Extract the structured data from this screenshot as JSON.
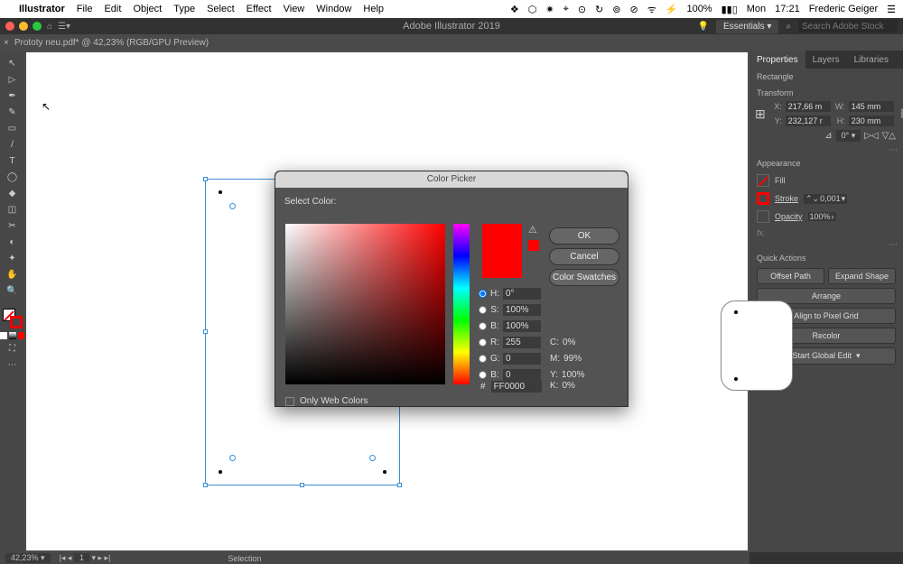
{
  "menubar": {
    "apple": "",
    "app": "Illustrator",
    "items": [
      "File",
      "Edit",
      "Object",
      "Type",
      "Select",
      "Effect",
      "View",
      "Window",
      "Help"
    ],
    "right_icons": [
      "❖",
      "⬡",
      "✷",
      "⌖",
      "⊙",
      "↻",
      "⊚",
      "⊘",
      "ᯤ",
      "⚡"
    ],
    "volume": "100%",
    "battery": "▮▮▯",
    "day": "Mon",
    "time": "17:21",
    "user": "Frederic Geiger",
    "menuicon": "☰"
  },
  "appbar": {
    "title": "Adobe Illustrator 2019",
    "workspace": "Essentials",
    "search_placeholder": "Search Adobe Stock",
    "bulb": "💡",
    "mglass": "⌕"
  },
  "tab": {
    "name": "Prototy neu.pdf* @ 42,23% (RGB/GPU Preview)"
  },
  "tools": [
    "↖",
    "▷",
    "✒",
    "✎",
    "▭",
    "/",
    "T",
    "◯",
    "◆",
    "◫",
    "✂",
    "◐",
    "✦",
    "✋",
    "🔍"
  ],
  "rpanel": {
    "tabs": [
      "Properties",
      "Layers",
      "Libraries"
    ],
    "target": "Rectangle",
    "transform_label": "Transform",
    "x_label": "X:",
    "x": "217,66 m",
    "y_label": "Y:",
    "y": "232,127 r",
    "w_label": "W:",
    "w": "145 mm",
    "h_label": "H:",
    "h": "230 mm",
    "angle_label": "⊿",
    "angle": "0°",
    "appearance_label": "Appearance",
    "fill_label": "Fill",
    "stroke_label": "Stroke",
    "stroke_val": "0,001",
    "opacity_label": "Opacity",
    "opacity_val": "100%",
    "fx": "fx.",
    "quick_label": "Quick Actions",
    "qa_offset": "Offset Path",
    "qa_expand": "Expand Shape",
    "qa_arrange": "Arrange",
    "qa_align": "Align to Pixel Grid",
    "qa_recolor": "Recolor",
    "qa_global": "Start Global Edit"
  },
  "cp": {
    "title": "Color Picker",
    "select_label": "Select Color:",
    "ok": "OK",
    "cancel": "Cancel",
    "swatches": "Color Swatches",
    "h_label": "H:",
    "h": "0°",
    "s_label": "S:",
    "s": "100%",
    "b_label": "B:",
    "b": "100%",
    "r_label": "R:",
    "r": "255",
    "g_label": "G:",
    "g": "0",
    "bl_label": "B:",
    "bl": "0",
    "c_label": "C:",
    "c": "0%",
    "m_label": "M:",
    "m": "99%",
    "yy_label": "Y:",
    "yy": "100%",
    "k_label": "K:",
    "k": "0%",
    "hex_label": "#",
    "hex": "FF0000",
    "owc": "Only Web Colors",
    "warn": "⚠"
  },
  "status": {
    "zoom": "42,23%",
    "nav": "1",
    "mode": "Selection"
  }
}
